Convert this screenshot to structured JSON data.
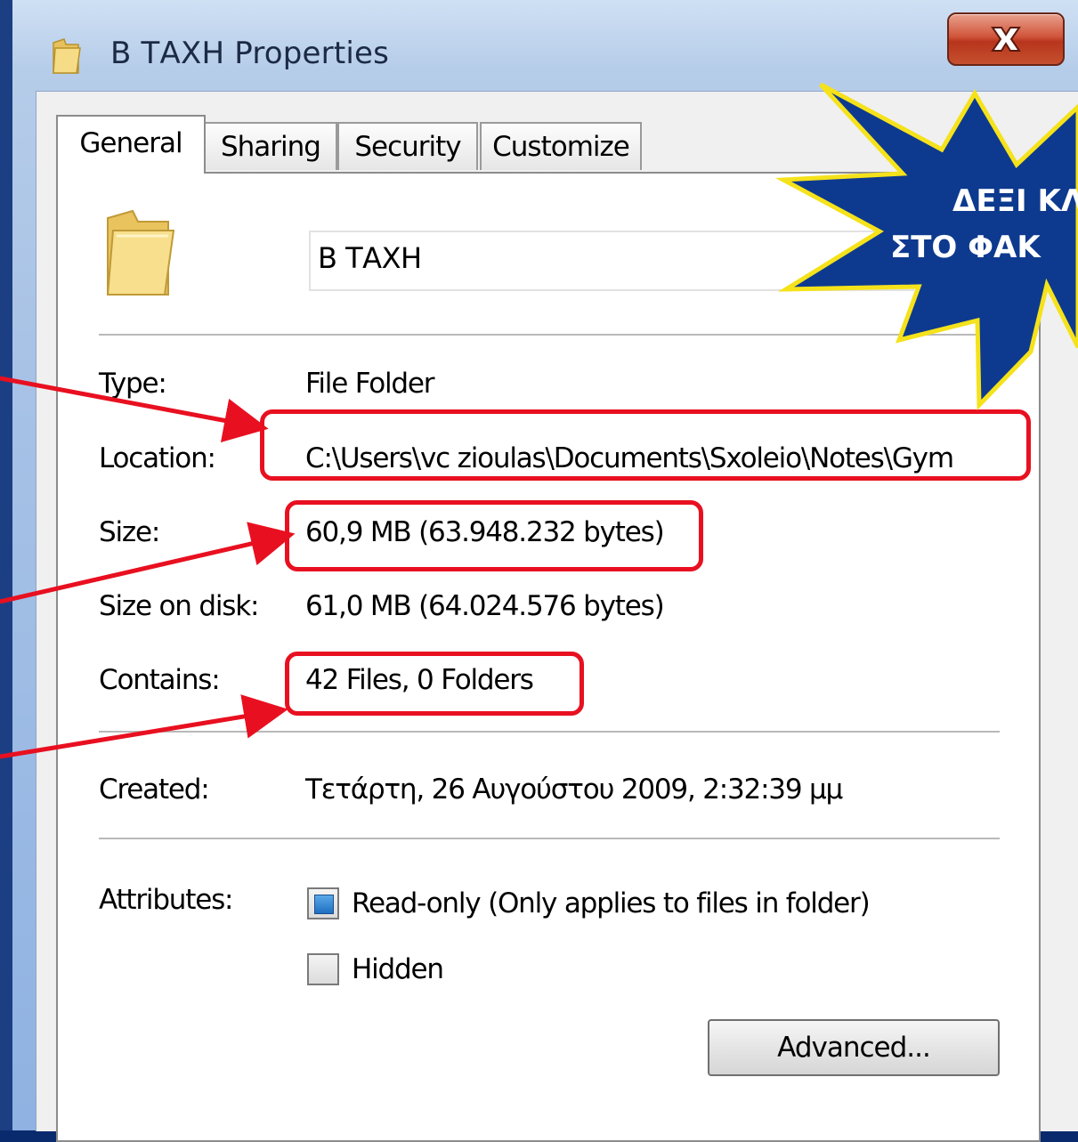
{
  "window": {
    "title": "Β ΤΑΧΗ Properties",
    "close_icon": "close-icon"
  },
  "tabs": [
    {
      "label": "General",
      "active": true
    },
    {
      "label": "Sharing",
      "active": false
    },
    {
      "label": "Security",
      "active": false
    },
    {
      "label": "Customize",
      "active": false
    }
  ],
  "general": {
    "folder_name": "Β ΤΑΧΗ",
    "type_label": "Type:",
    "type_value": "File Folder",
    "location_label": "Location:",
    "location_value": "C:\\Users\\vc zioulas\\Documents\\Sxoleio\\Notes\\Gym",
    "size_label": "Size:",
    "size_value": "60,9 MB (63.948.232 bytes)",
    "size_on_disk_label": "Size on disk:",
    "size_on_disk_value": "61,0 MB (64.024.576 bytes)",
    "contains_label": "Contains:",
    "contains_value": "42 Files, 0 Folders",
    "created_label": "Created:",
    "created_value": "Τετάρτη, 26 Αυγούστου 2009, 2:32:39 μμ",
    "attributes_label": "Attributes:",
    "readonly_label": "Read-only (Only applies to files in folder)",
    "readonly_state": "indeterminate",
    "hidden_label": "Hidden",
    "hidden_checked": false,
    "advanced_button": "Advanced..."
  },
  "annotation": {
    "star_line1": "ΔΕΞΙ ΚΛ",
    "star_line2": "ΣΤΟ ΦΑΚ",
    "star_color": "#0d3a8f",
    "star_border": "#f5e21a",
    "highlight_color": "#e81020"
  }
}
